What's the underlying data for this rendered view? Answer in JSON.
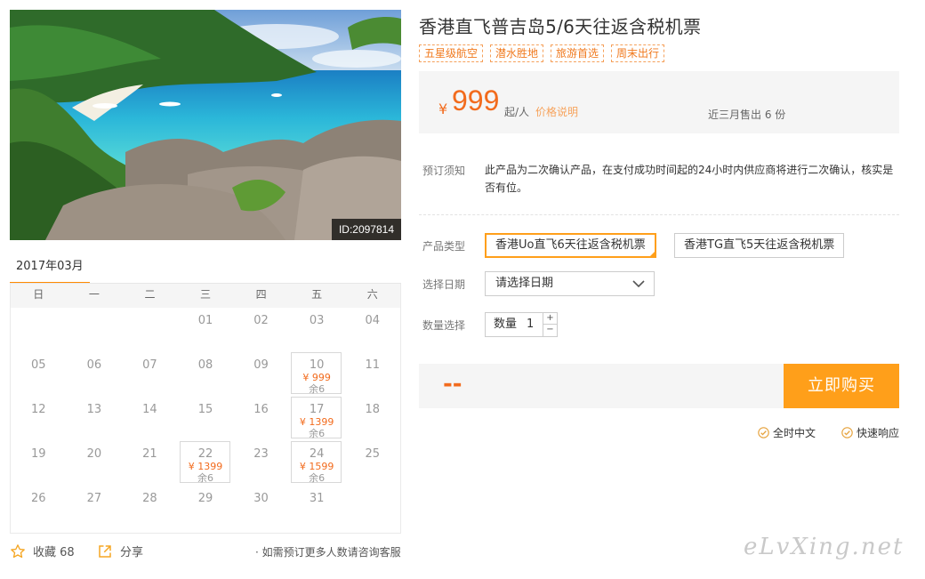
{
  "photo": {
    "id_badge": "ID:2097814"
  },
  "calendar": {
    "month": "2017年03月",
    "weekdays": [
      "日",
      "一",
      "二",
      "三",
      "四",
      "五",
      "六"
    ],
    "weeks": [
      [
        {
          "d": ""
        },
        {
          "d": ""
        },
        {
          "d": ""
        },
        {
          "d": "01"
        },
        {
          "d": "02"
        },
        {
          "d": "03"
        },
        {
          "d": "04"
        }
      ],
      [
        {
          "d": "05"
        },
        {
          "d": "06"
        },
        {
          "d": "07"
        },
        {
          "d": "08"
        },
        {
          "d": "09"
        },
        {
          "d": "10",
          "price": "¥ 999",
          "left": "余6"
        },
        {
          "d": "11"
        }
      ],
      [
        {
          "d": "12"
        },
        {
          "d": "13"
        },
        {
          "d": "14"
        },
        {
          "d": "15"
        },
        {
          "d": "16"
        },
        {
          "d": "17",
          "price": "¥ 1399",
          "left": "余6"
        },
        {
          "d": "18"
        }
      ],
      [
        {
          "d": "19"
        },
        {
          "d": "20"
        },
        {
          "d": "21"
        },
        {
          "d": "22",
          "price": "¥ 1399",
          "left": "余6"
        },
        {
          "d": "23"
        },
        {
          "d": "24",
          "price": "¥ 1599",
          "left": "余6"
        },
        {
          "d": "25"
        }
      ],
      [
        {
          "d": "26"
        },
        {
          "d": "27"
        },
        {
          "d": "28"
        },
        {
          "d": "29"
        },
        {
          "d": "30"
        },
        {
          "d": "31"
        },
        {
          "d": ""
        }
      ]
    ]
  },
  "footer": {
    "favorite_label": "收藏 68",
    "share_label": "分享",
    "consult_text": "· 如需预订更多人数请咨询客服"
  },
  "product": {
    "title": "香港直飞普吉岛5/6天往返含税机票",
    "tags": [
      "五星级航空",
      "潜水胜地",
      "旅游首选",
      "周末出行"
    ],
    "currency": "¥",
    "price": "999",
    "unit": "起/人",
    "price_note": "价格说明",
    "sold": "近三月售出 6 份"
  },
  "booking": {
    "notice_label": "预订须知",
    "notice_text": "此产品为二次确认产品，在支付成功时间起的24小时内供应商将进行二次确认，核实是否有位。",
    "type_label": "产品类型",
    "types": [
      "香港Uo直飞6天往返含税机票",
      "香港TG直飞5天往返含税机票"
    ],
    "selected_type_index": 0,
    "date_label": "选择日期",
    "date_placeholder": "请选择日期",
    "qty_label": "数量选择",
    "qty_field_label": "数量",
    "qty_value": "1",
    "plus": "+",
    "minus": "−",
    "total": "--",
    "buy_label": "立即购买"
  },
  "assurances": [
    "全时中文",
    "快速响应"
  ],
  "watermark": "eLvXing.net",
  "colors": {
    "accent": "#ff9f1a",
    "price": "#f26b1d",
    "tag_border": "#f5a05a"
  }
}
